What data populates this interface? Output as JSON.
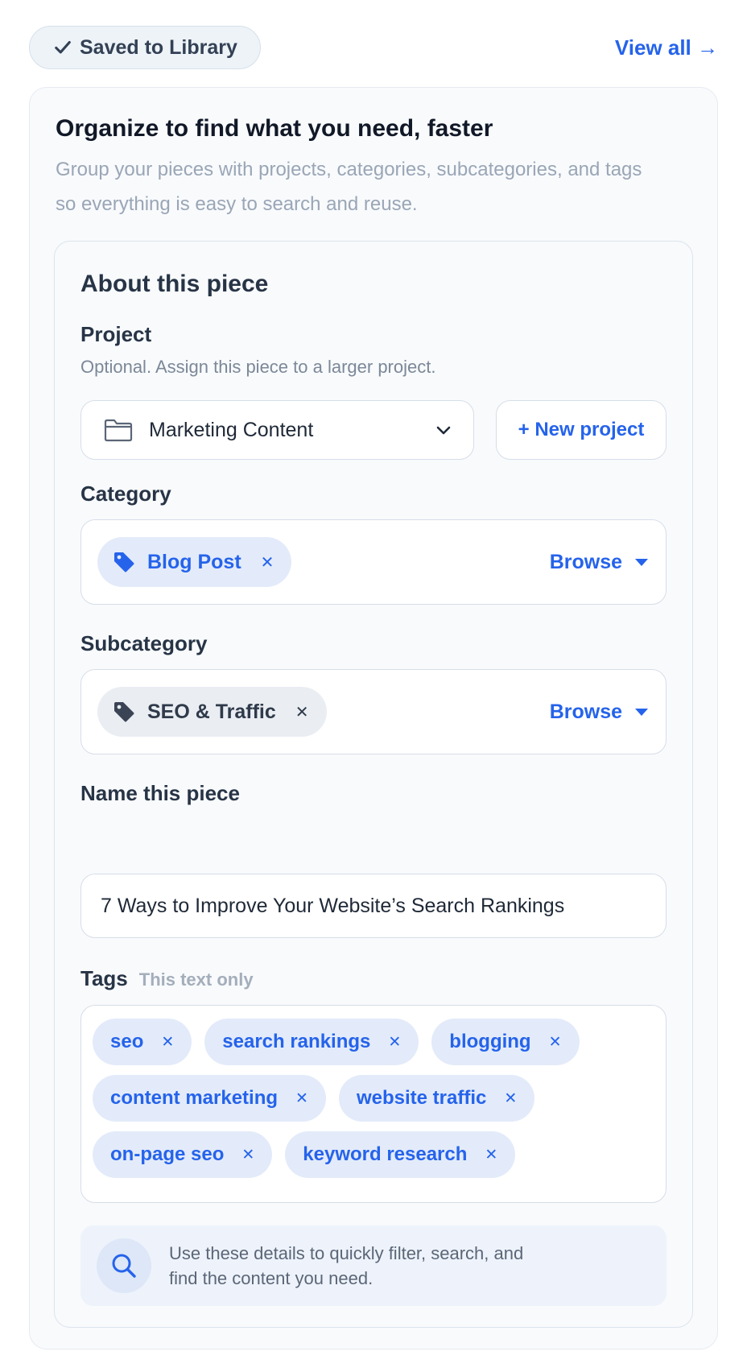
{
  "header": {
    "saved_badge": "Saved to Library",
    "view_all": "View all →"
  },
  "intro": {
    "title": "Organize to find what you need, faster",
    "description": "Group your pieces with projects, categories, subcategories, and tags so everything is easy to search and reuse."
  },
  "form": {
    "section_title": "About this piece",
    "project": {
      "label": "Project",
      "hint": "Optional. Assign this piece to a larger project.",
      "selected": "Marketing Content",
      "new_button": "+ New project"
    },
    "category": {
      "label": "Category",
      "chip": "Blog Post",
      "browse": "Browse"
    },
    "subcategory": {
      "label": "Subcategory",
      "chip": "SEO & Traffic",
      "browse": "Browse"
    },
    "name": {
      "label": "Name this piece",
      "value": "7 Ways to Improve Your Website’s Search Rankings"
    },
    "tags": {
      "label": "Tags",
      "sublabel": "This text only",
      "items": [
        "seo",
        "search rankings",
        "blogging",
        "content marketing",
        "website traffic",
        "on-page seo",
        "keyword research"
      ]
    },
    "info": {
      "text": "Use these details to quickly filter, search, and find the content you need."
    }
  },
  "icons": {
    "check": "check-icon",
    "folder": "folder-icon",
    "chevron": "chevron-down-icon",
    "tag": "tag-icon",
    "search": "search-icon",
    "remove": "close-icon"
  },
  "colors": {
    "accent": "#2563eb",
    "chip_bg": "#e3ebfa",
    "card_bg": "#f8fafc"
  }
}
